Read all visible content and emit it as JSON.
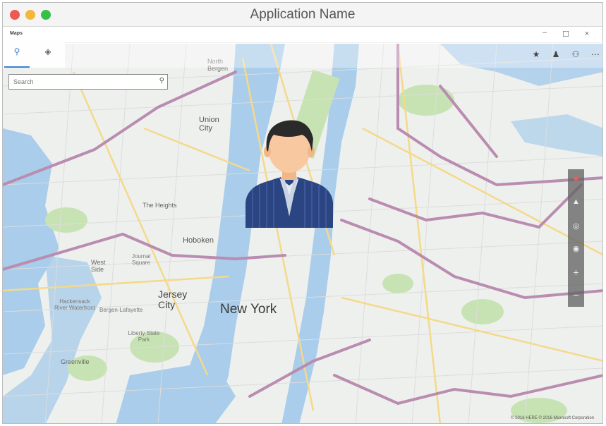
{
  "window": {
    "title": "Application Name"
  },
  "app_bar": {
    "app_name": "Maps",
    "minimize": "–",
    "maximize": "☐",
    "close": "×"
  },
  "panel": {
    "tabs": [
      {
        "icon": "search-icon",
        "glyph": "⚲"
      },
      {
        "icon": "directions-icon",
        "glyph": "◈"
      }
    ]
  },
  "search": {
    "placeholder": "Search",
    "button_glyph": "⚲"
  },
  "toolbar_icons": [
    {
      "icon": "favorites-icon",
      "glyph": "★"
    },
    {
      "icon": "notifications-icon",
      "glyph": "♟"
    },
    {
      "icon": "account-icon",
      "glyph": "⚇"
    },
    {
      "icon": "more-icon",
      "glyph": "⋯"
    }
  ],
  "map_controls": {
    "compass": "◆",
    "tilt": "▲",
    "locate": "◎",
    "layers": "◉",
    "zoom_in": "+",
    "zoom_out": "−"
  },
  "places": {
    "new_york": "New York",
    "jersey_city": "Jersey City",
    "hoboken": "Hoboken",
    "union_city": "Union City",
    "north_bergen": "North Bergen",
    "the_heights": "The Heights",
    "west_side": "West Side",
    "journal_square": "Journal Square",
    "hackensack_waterfront": "Hackensack River Waterfront",
    "bergen_lafayette": "Bergen-Lafayette",
    "liberty_state_park": "Liberty State Park",
    "greenville": "Greenville"
  },
  "copyright": "© 2016 HERE © 2016 Microsoft Corporation",
  "colors": {
    "water": "#a9cdea",
    "land": "#eef0ee",
    "park": "#c7e3b4",
    "highway": "#b98cb0",
    "major_road": "#f5d98a",
    "avatar_suit": "#2b4583",
    "avatar_skin": "#f8c8a0",
    "avatar_hair": "#2a2a2a"
  }
}
